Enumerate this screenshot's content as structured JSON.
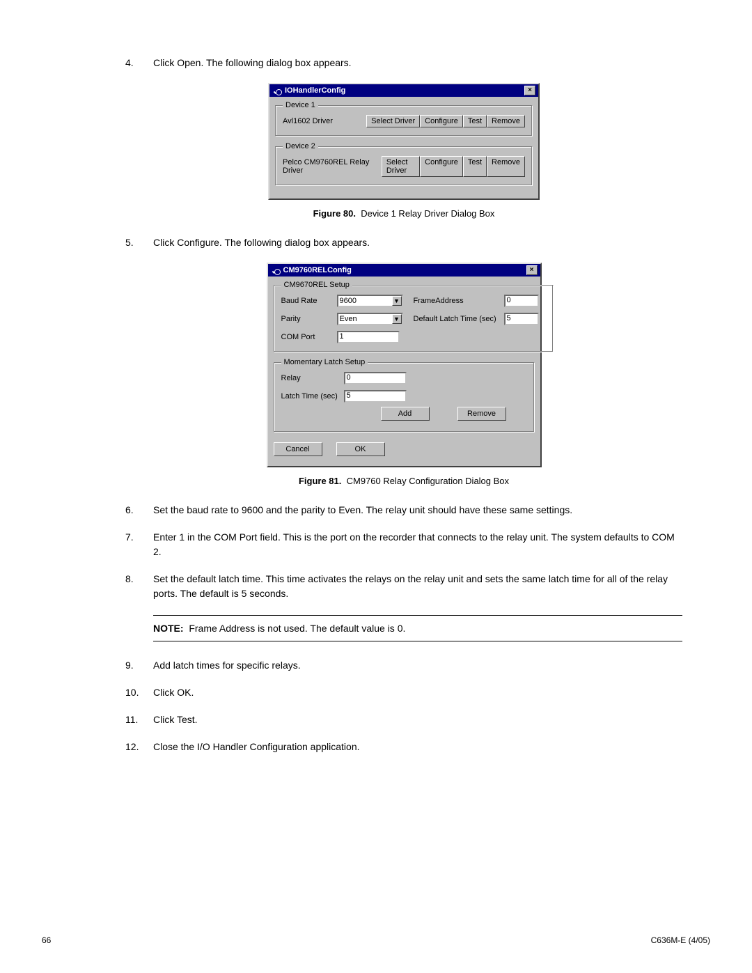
{
  "steps": {
    "s4": {
      "num": "4.",
      "text": "Click Open. The following dialog box appears."
    },
    "s5": {
      "num": "5.",
      "text": "Click Configure. The following dialog box appears."
    },
    "s6": {
      "num": "6.",
      "text": "Set the baud rate to 9600 and the parity to Even. The relay unit should have these same settings."
    },
    "s7": {
      "num": "7.",
      "text": "Enter 1 in the COM Port field. This is the port on the recorder that connects to the relay unit. The system defaults to COM 2."
    },
    "s8": {
      "num": "8.",
      "text": "Set the default latch time. This time activates the relays on the relay unit and sets the same latch time for all of the relay ports. The default is 5 seconds."
    },
    "s9": {
      "num": "9.",
      "text": "Add latch times for specific relays."
    },
    "s10": {
      "num": "10.",
      "text": "Click OK."
    },
    "s11": {
      "num": "11.",
      "text": "Click Test."
    },
    "s12": {
      "num": "12.",
      "text": "Close the I/O Handler Configuration application."
    }
  },
  "dialog1": {
    "title": "IOHandlerConfig",
    "close": "×",
    "device1": {
      "legend": "Device 1",
      "driver": "Avl1602 Driver"
    },
    "device2": {
      "legend": "Device 2",
      "driver": "Pelco CM9760REL Relay Driver"
    },
    "buttons": {
      "select_driver": "Select Driver",
      "configure": "Configure",
      "test": "Test",
      "remove": "Remove"
    }
  },
  "fig80": {
    "label": "Figure 80.",
    "caption": "Device 1 Relay Driver Dialog Box"
  },
  "dialog2": {
    "title": "CM9760RELConfig",
    "close": "×",
    "setup": {
      "legend": "CM9670REL Setup",
      "baud_label": "Baud Rate",
      "baud_value": "9600",
      "frame_label": "FrameAddress",
      "frame_value": "0",
      "parity_label": "Parity",
      "parity_value": "Even",
      "latch_default_label": "Default Latch Time (sec)",
      "latch_default_value": "5",
      "com_label": "COM Port",
      "com_value": "1"
    },
    "momentary": {
      "legend": "Momentary Latch Setup",
      "relay_label": "Relay",
      "relay_value": "0",
      "latch_label": "Latch Time (sec)",
      "latch_value": "5",
      "add": "Add",
      "remove": "Remove"
    },
    "buttons": {
      "cancel": "Cancel",
      "ok": "OK"
    },
    "dropdown_arrow": "▼"
  },
  "fig81": {
    "label": "Figure 81.",
    "caption": "CM9760 Relay Configuration Dialog Box"
  },
  "note": {
    "label": "NOTE:",
    "text": "Frame Address is not used. The default value is 0."
  },
  "footer": {
    "page": "66",
    "doc": "C636M-E (4/05)"
  }
}
